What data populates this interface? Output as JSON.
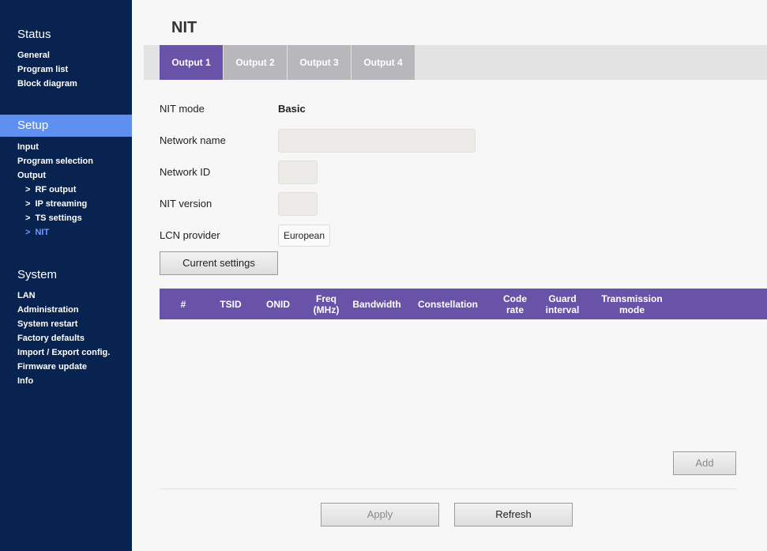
{
  "sidebar": {
    "status": {
      "title": "Status",
      "items": [
        "General",
        "Program list",
        "Block diagram"
      ]
    },
    "setup": {
      "title": "Setup",
      "items": [
        "Input",
        "Program selection",
        "Output"
      ],
      "subitems": [
        "RF output",
        "IP streaming",
        "TS settings",
        "NIT"
      ]
    },
    "system": {
      "title": "System",
      "items": [
        "LAN",
        "Administration",
        "System restart",
        "Factory defaults",
        "Import / Export config.",
        "Firmware update",
        "Info"
      ]
    },
    "arrow": ">"
  },
  "page": {
    "title": "NIT"
  },
  "tabs": [
    "Output 1",
    "Output 2",
    "Output 3",
    "Output 4"
  ],
  "form": {
    "nit_mode_label": "NIT mode",
    "nit_mode_value": "Basic",
    "network_name_label": "Network name",
    "network_name_value": "",
    "network_id_label": "Network ID",
    "network_id_value": "",
    "nit_version_label": "NIT version",
    "nit_version_value": "",
    "lcn_provider_label": "LCN provider",
    "lcn_provider_value": "European"
  },
  "buttons": {
    "current_settings": "Current settings",
    "add": "Add",
    "apply": "Apply",
    "refresh": "Refresh"
  },
  "table": {
    "headers": [
      "#",
      "TSID",
      "ONID",
      "Freq\n(MHz)",
      "Bandwidth",
      "Constellation",
      "Code\nrate",
      "Guard\ninterval",
      "Transmission\nmode"
    ],
    "rows": []
  },
  "colors": {
    "sidebar_bg": "#08234f",
    "accent": "#6853a8",
    "sidebar_active": "#5f8ff0",
    "nav_active_text": "#6d9bff"
  }
}
